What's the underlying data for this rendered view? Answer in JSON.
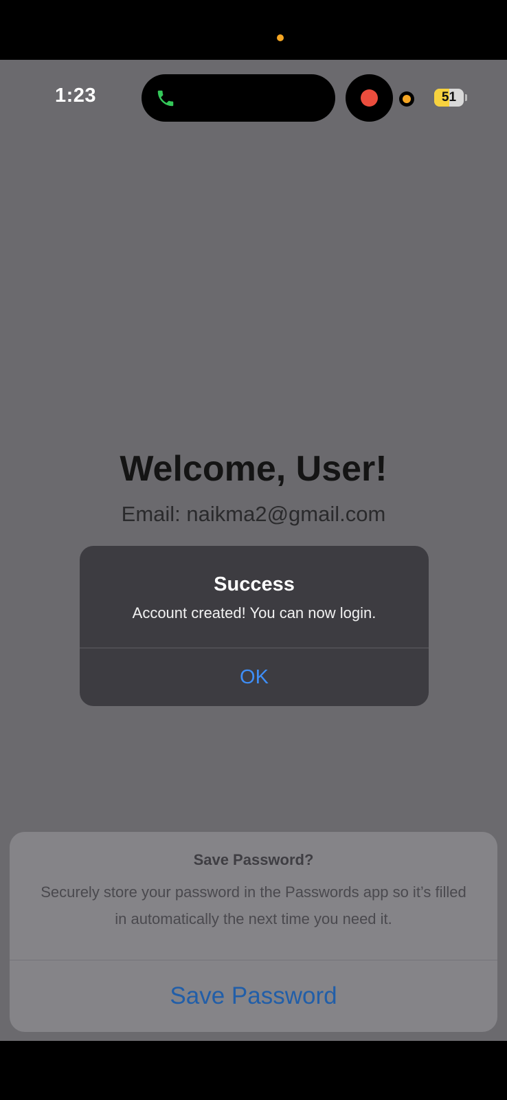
{
  "status_bar": {
    "time": "1:23",
    "battery_level": "51",
    "battery_fraction": 0.51,
    "call_icon": "phone-icon",
    "recording_indicator": "recording-dot"
  },
  "colors": {
    "call_green": "#34c759",
    "recording_red": "#eb4d3d",
    "privacy_orange": "#f5a623",
    "battery_yellow": "#f7d23e",
    "link_blue": "#3e8ef7"
  },
  "welcome": {
    "title": "Welcome, User!",
    "email": "Email: naikma2@gmail.com"
  },
  "alert": {
    "title": "Success",
    "message": "Account created! You can now login.",
    "ok_label": "OK"
  },
  "save_password_sheet": {
    "title": "Save Password?",
    "message": "Securely store your password in the Passwords app so it’s filled in automatically the next time you need it.",
    "save_label": "Save Password"
  }
}
